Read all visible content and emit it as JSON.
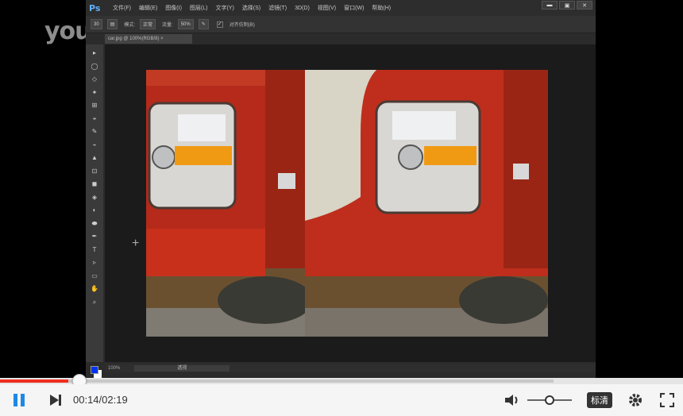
{
  "watermark": {
    "logo": "youku"
  },
  "photoshop": {
    "logo": "Ps",
    "menu": [
      "文件(F)",
      "编辑(E)",
      "图像(I)",
      "图层(L)",
      "文字(Y)",
      "选择(S)",
      "滤镜(T)",
      "3D(D)",
      "视图(V)",
      "窗口(W)",
      "帮助(H)"
    ],
    "window_controls": [
      "▬",
      "▣",
      "✕"
    ],
    "options": {
      "brush_size": "30",
      "mode_label": "模式:",
      "mode_value": "正常",
      "opacity_label": "流量:",
      "opacity_value": "50%",
      "align_label": "对齐仿制(B)"
    },
    "doc_tab": "car.jpg @ 100%(RGB/8) ×",
    "status": {
      "zoom": "100%",
      "scroll_label": "透视"
    },
    "tools": [
      "▸",
      "◯",
      "◇",
      "✦",
      "⊞",
      "⌖",
      "✎",
      "⌁",
      "▲",
      "⊡",
      "◼",
      "◈",
      "◐",
      "⬬",
      "✒",
      "T",
      "▹",
      "▭",
      "✋",
      "⌕"
    ],
    "colors": {
      "foreground": "#0033ee",
      "background": "#ffffff"
    }
  },
  "player": {
    "current_time": "00:14/02:19",
    "progress_fraction": 0.1,
    "buffered_fraction": 0.81,
    "volume_fraction": 0.5,
    "quality": "标清",
    "icons": [
      "pause-icon",
      "next-icon",
      "volume-icon",
      "settings-icon",
      "fullscreen-icon"
    ]
  }
}
